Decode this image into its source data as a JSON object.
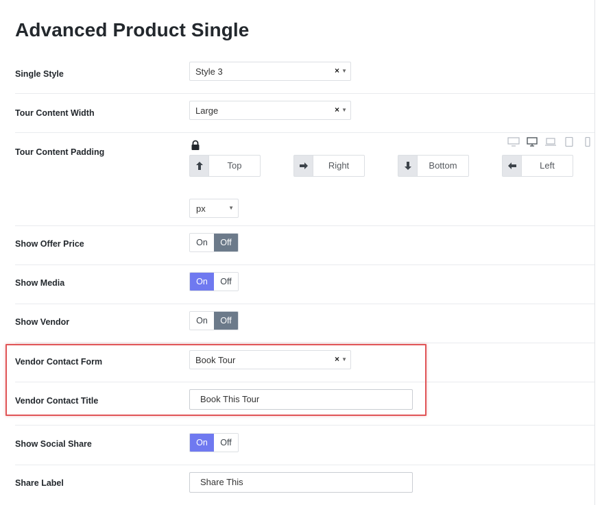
{
  "page": {
    "title": "Advanced Product Single"
  },
  "settings": {
    "single_style": {
      "label": "Single Style",
      "value": "Style 3",
      "clear": "×",
      "arrow": "▼"
    },
    "tour_content_width": {
      "label": "Tour Content Width",
      "value": "Large",
      "clear": "×",
      "arrow": "▼"
    },
    "tour_content_padding": {
      "label": "Tour Content Padding",
      "lock_icon": "lock-icon",
      "device_icons": [
        "desktop-wide-icon",
        "desktop-icon",
        "laptop-icon",
        "tablet-icon",
        "mobile-icon"
      ],
      "active_device": "desktop-icon",
      "fields": [
        {
          "placeholder": "Top",
          "arrow": "up-arrow-icon"
        },
        {
          "placeholder": "Right",
          "arrow": "right-arrow-icon"
        },
        {
          "placeholder": "Bottom",
          "arrow": "down-arrow-icon"
        },
        {
          "placeholder": "Left",
          "arrow": "left-arrow-icon"
        }
      ],
      "unit": "px",
      "unit_arrow": "▼"
    },
    "show_offer_price": {
      "label": "Show Offer Price",
      "on": "On",
      "off": "Off",
      "selected": "Off"
    },
    "show_media": {
      "label": "Show Media",
      "on": "On",
      "off": "Off",
      "selected": "On"
    },
    "show_vendor": {
      "label": "Show Vendor",
      "on": "On",
      "off": "Off",
      "selected": "Off"
    },
    "vendor_contact_form": {
      "label": "Vendor Contact Form",
      "value": "Book Tour",
      "clear": "×",
      "arrow": "▼"
    },
    "vendor_contact_title": {
      "label": "Vendor Contact Title",
      "value": "Book This Tour"
    },
    "show_social_share": {
      "label": "Show Social Share",
      "on": "On",
      "off": "Off",
      "selected": "On"
    },
    "share_label": {
      "label": "Share Label",
      "value": "Share This"
    }
  },
  "colors": {
    "toggle_on_active": "#6f79f0",
    "toggle_off_active": "#6c7a8a",
    "highlight_border": "#e05456"
  }
}
